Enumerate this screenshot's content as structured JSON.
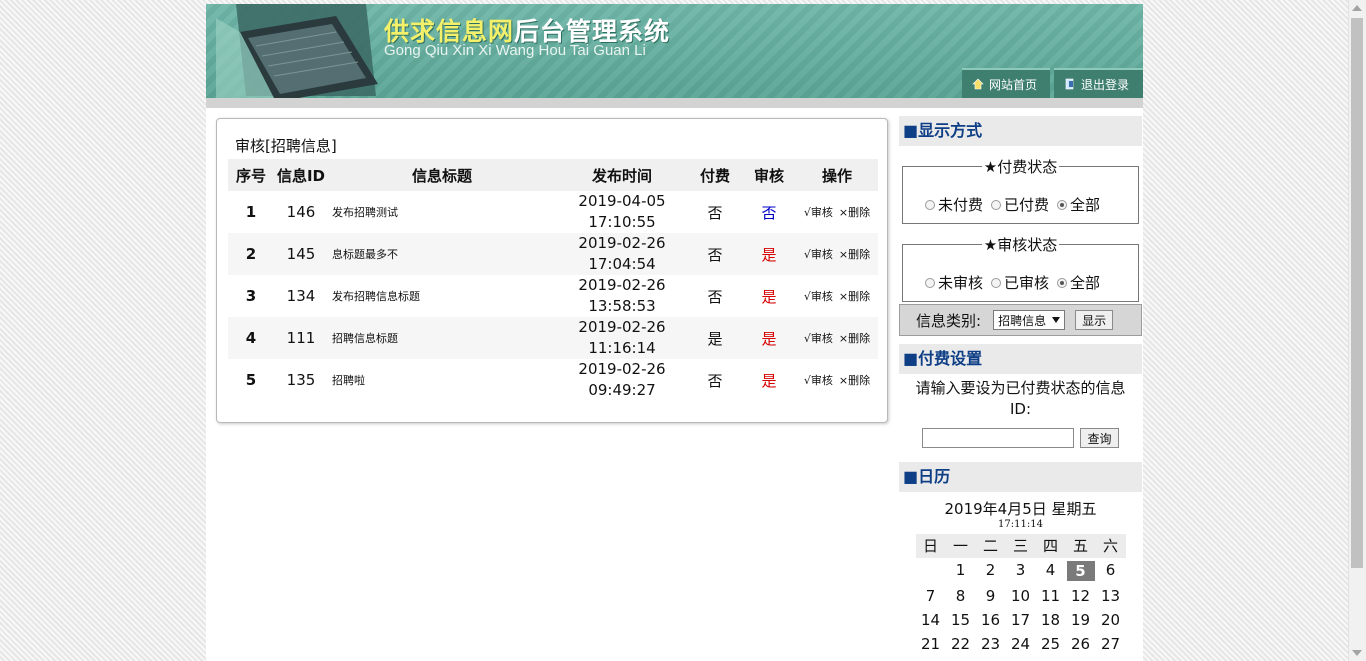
{
  "header": {
    "logo_cn_highlight": "供求信息网",
    "logo_cn_rest": "后台管理系统",
    "logo_en": "Gong Qiu Xin Xi Wang Hou Tai Guan Li",
    "home_label": "网站首页",
    "logout_label": "退出登录"
  },
  "main": {
    "title": "审核[招聘信息]",
    "columns": [
      "序号",
      "信息ID",
      "信息标题",
      "发布时间",
      "付费",
      "审核",
      "操作"
    ],
    "rows": [
      {
        "no": "1",
        "id": "146",
        "title": "发布招聘测试",
        "date": "2019-04-05",
        "time": "17:10:55",
        "paid": "否",
        "audit": "否",
        "audit_color": "#0000c8"
      },
      {
        "no": "2",
        "id": "145",
        "title": "息标题最多不",
        "date": "2019-02-26",
        "time": "17:04:54",
        "paid": "否",
        "audit": "是",
        "audit_color": "#d80000"
      },
      {
        "no": "3",
        "id": "134",
        "title": "发布招聘信息标题",
        "date": "2019-02-26",
        "time": "13:58:53",
        "paid": "否",
        "audit": "是",
        "audit_color": "#d80000"
      },
      {
        "no": "4",
        "id": "111",
        "title": "招聘信息标题",
        "date": "2019-02-26",
        "time": "11:16:14",
        "paid": "是",
        "audit": "是",
        "audit_color": "#d80000"
      },
      {
        "no": "5",
        "id": "135",
        "title": "招聘啦",
        "date": "2019-02-26",
        "time": "09:49:27",
        "paid": "否",
        "audit": "是",
        "audit_color": "#d80000"
      }
    ],
    "op_audit": "√审核",
    "op_delete": "×删除"
  },
  "sidebar": {
    "display_heading": "■显示方式",
    "pay_status": {
      "legend": "★付费状态",
      "options": [
        "未付费",
        "已付费",
        "全部"
      ],
      "selected": "全部"
    },
    "audit_status": {
      "legend": "★审核状态",
      "options": [
        "未审核",
        "已审核",
        "全部"
      ],
      "selected": "全部"
    },
    "category_label": "信息类别:",
    "category_value": "招聘信息",
    "show_button": "显示",
    "pay_heading": "■付费设置",
    "pay_prompt": "请输入要设为已付费状态的信息ID:",
    "query_button": "查询",
    "calendar_heading": "■日历",
    "calendar_date": "2019年4月5日 星期五",
    "calendar_time": "17:11:14",
    "weekdays": [
      "日",
      "一",
      "二",
      "三",
      "四",
      "五",
      "六"
    ],
    "weeks": [
      [
        "",
        "1",
        "2",
        "3",
        "4",
        "5",
        "6"
      ],
      [
        "7",
        "8",
        "9",
        "10",
        "11",
        "12",
        "13"
      ],
      [
        "14",
        "15",
        "16",
        "17",
        "18",
        "19",
        "20"
      ],
      [
        "21",
        "22",
        "23",
        "24",
        "25",
        "26",
        "27"
      ]
    ],
    "today": "5"
  }
}
